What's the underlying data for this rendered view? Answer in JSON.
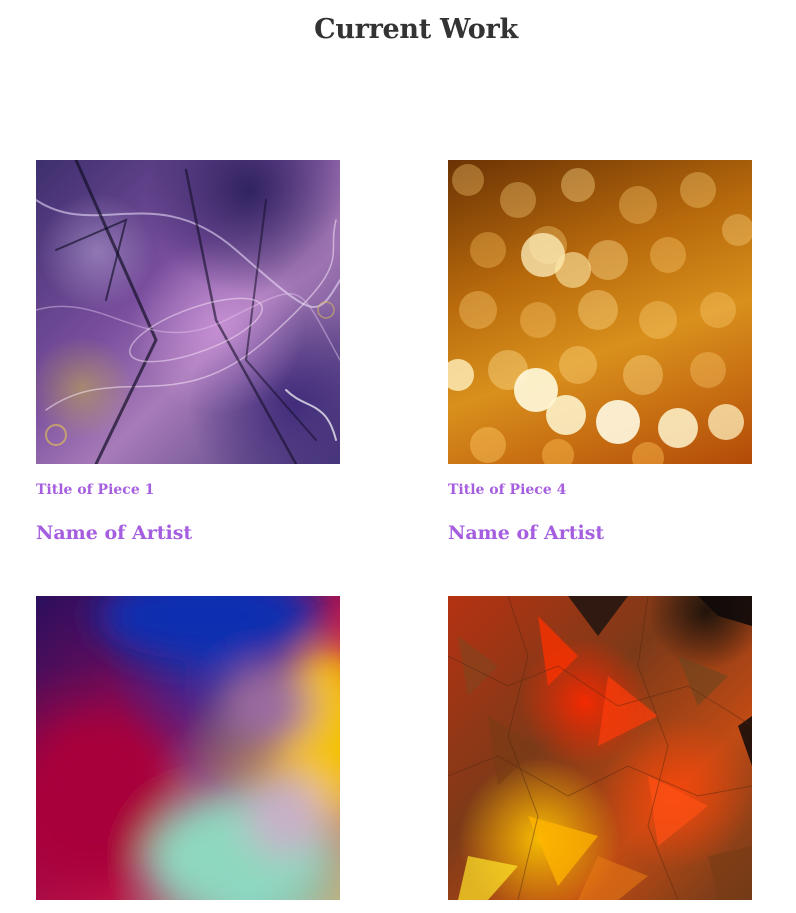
{
  "page": {
    "title": "Current Work"
  },
  "works": [
    {
      "piece_title": "Title of Piece 1",
      "artist": "Name of Artist",
      "artwork_icon": "abstract-purple-artwork"
    },
    {
      "piece_title": "Title of Piece 4",
      "artist": "Name of Artist",
      "artwork_icon": "golden-bokeh-artwork"
    },
    {
      "piece_title": "",
      "artist": "",
      "artwork_icon": "blurred-rainbow-artwork"
    },
    {
      "piece_title": "",
      "artist": "",
      "artwork_icon": "orange-crackle-artwork"
    }
  ],
  "colors": {
    "title": "#333333",
    "accent": "#a55ee0",
    "background": "#ffffff"
  }
}
